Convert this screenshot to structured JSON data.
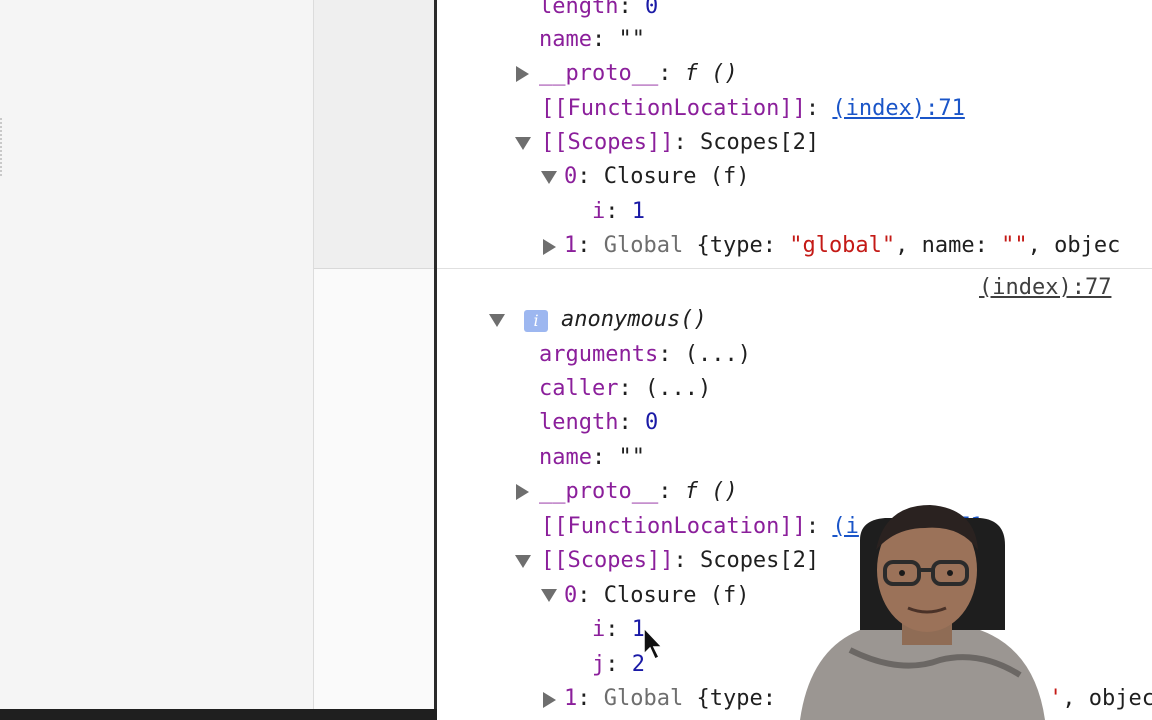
{
  "console": {
    "group1": {
      "length_key": "length",
      "length_val": "0",
      "name_key": "name",
      "name_val": "\"\"",
      "proto_key": "__proto__",
      "proto_val": "f ()",
      "fnloc_key": "[[FunctionLocation]]",
      "fnloc_link": "(index):71",
      "scopes_key": "[[Scopes]]",
      "scopes_val": "Scopes[2]",
      "closure_idx": "0",
      "closure_label": "Closure (f)",
      "i_key": "i",
      "i_val": "1",
      "global_idx": "1",
      "global_label": "Global",
      "global_obj_open": "{type: ",
      "global_type_val": "\"global\"",
      "global_name_key": ", name: ",
      "global_name_val": "\"\"",
      "global_tail": ", objec"
    },
    "group2": {
      "source_link": "(index):77",
      "info_badge": "i",
      "title": "anonymous()",
      "arguments_key": "arguments",
      "arguments_val": "(...)",
      "caller_key": "caller",
      "caller_val": "(...)",
      "length_key": "length",
      "length_val": "0",
      "name_key": "name",
      "name_val": "\"\"",
      "proto_key": "__proto__",
      "proto_val": "f ()",
      "fnloc_key": "[[FunctionLocation]]",
      "fnloc_link": "(i",
      "fnloc_link_tail": "71",
      "scopes_key": "[[Scopes]]",
      "scopes_val": "Scopes[2]",
      "closure_idx": "0",
      "closure_label": "Closure (f)",
      "i_key": "i",
      "i_val": "1",
      "j_key": "j",
      "j_val": "2",
      "global_idx": "1",
      "global_label": "Global",
      "global_obj_open": "{type: ",
      "global_tail_a": "'",
      "global_tail_b": ", objec"
    }
  },
  "colors": {
    "key": "#8b1f9b",
    "number": "#1a1aa6",
    "string": "#c41a16",
    "link": "#1a55c8"
  }
}
